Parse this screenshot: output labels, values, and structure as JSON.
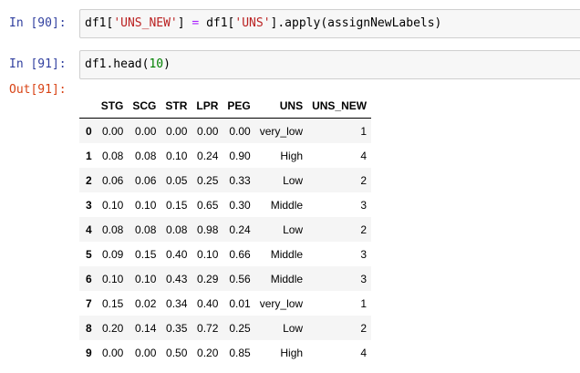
{
  "cells": [
    {
      "prompt": "In [90]:",
      "code": {
        "a": "df1[",
        "b": "'UNS_NEW'",
        "c": "] ",
        "d": "=",
        "e": " df1[",
        "f": "'UNS'",
        "g": "].apply(assignNewLabels)"
      }
    },
    {
      "prompt": "In [91]:",
      "code": {
        "a": "df1.head(",
        "b": "10",
        "c": ")"
      }
    }
  ],
  "output": {
    "prompt": "Out[91]:",
    "columns": [
      "",
      "STG",
      "SCG",
      "STR",
      "LPR",
      "PEG",
      "UNS",
      "UNS_NEW"
    ],
    "rows": [
      [
        "0",
        "0.00",
        "0.00",
        "0.00",
        "0.00",
        "0.00",
        "very_low",
        "1"
      ],
      [
        "1",
        "0.08",
        "0.08",
        "0.10",
        "0.24",
        "0.90",
        "High",
        "4"
      ],
      [
        "2",
        "0.06",
        "0.06",
        "0.05",
        "0.25",
        "0.33",
        "Low",
        "2"
      ],
      [
        "3",
        "0.10",
        "0.10",
        "0.15",
        "0.65",
        "0.30",
        "Middle",
        "3"
      ],
      [
        "4",
        "0.08",
        "0.08",
        "0.08",
        "0.98",
        "0.24",
        "Low",
        "2"
      ],
      [
        "5",
        "0.09",
        "0.15",
        "0.40",
        "0.10",
        "0.66",
        "Middle",
        "3"
      ],
      [
        "6",
        "0.10",
        "0.10",
        "0.43",
        "0.29",
        "0.56",
        "Middle",
        "3"
      ],
      [
        "7",
        "0.15",
        "0.02",
        "0.34",
        "0.40",
        "0.01",
        "very_low",
        "1"
      ],
      [
        "8",
        "0.20",
        "0.14",
        "0.35",
        "0.72",
        "0.25",
        "Low",
        "2"
      ],
      [
        "9",
        "0.00",
        "0.00",
        "0.50",
        "0.20",
        "0.85",
        "High",
        "4"
      ]
    ]
  },
  "colors": {
    "in_prompt": "#303f9f",
    "out_prompt": "#d84315",
    "string": "#ba2121",
    "operator": "#aa22ff",
    "number": "#008000",
    "input_bg": "#f7f7f7",
    "row_stripe": "#f5f5f5"
  }
}
